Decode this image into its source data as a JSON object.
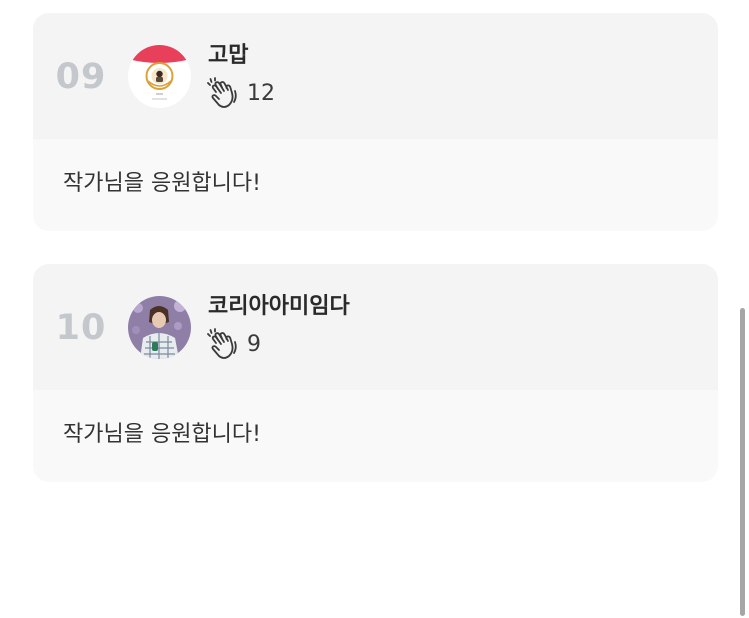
{
  "comments": [
    {
      "rank": "09",
      "author": "고맙",
      "cheer_count": "12",
      "message": "작가님을 응원합니다!"
    },
    {
      "rank": "10",
      "author": "코리아아미임다",
      "cheer_count": "9",
      "message": "작가님을 응원합니다!"
    }
  ],
  "colors": {
    "card_bg": "#f9f9fa",
    "card_header_bg": "#f4f4f5",
    "rank_color": "#c4c7cc",
    "text": "#2b2b2b"
  },
  "icons": {
    "cheer": "clapping-hands-icon"
  }
}
